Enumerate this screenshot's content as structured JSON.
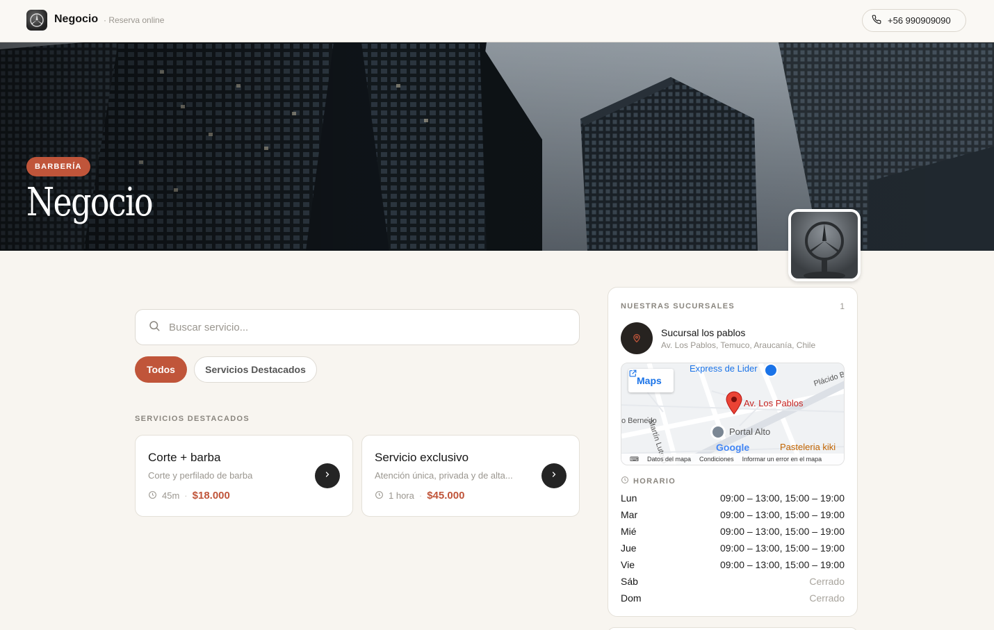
{
  "header": {
    "brand_name": "Negocio",
    "brand_sub": "· Reserva online",
    "phone": "+56 990909090"
  },
  "hero": {
    "tag": "BARBERÍA",
    "title": "Negocio"
  },
  "search": {
    "placeholder": "Buscar servicio..."
  },
  "filters": [
    {
      "label": "Todos",
      "active": true
    },
    {
      "label": "Servicios Destacados",
      "active": false
    }
  ],
  "featured": {
    "section_label": "SERVICIOS DESTACADOS",
    "services": [
      {
        "title": "Corte + barba",
        "description": "Corte y perfilado de barba",
        "duration": "45m",
        "price": "$18.000"
      },
      {
        "title": "Servicio exclusivo",
        "description": "Atención única, privada y de alta...",
        "duration": "1 hora",
        "price": "$45.000"
      }
    ]
  },
  "branches": {
    "heading": "NUESTRAS SUCURSALES",
    "count": "1",
    "branch": {
      "name": "Sucursal los pablos",
      "address": "Av. Los Pablos, Temuco, Araucanía, Chile"
    },
    "map": {
      "button": "Maps",
      "labels": {
        "express": "Express de Lider",
        "place": "Av. Los Pablos",
        "portal": "Portal Alto",
        "pasteleria": "Pasteleria kiki",
        "placido": "Plácido B",
        "bernedo": "o Bernedo",
        "lutero": ". Martín Lutero",
        "google": "Google"
      },
      "footer": [
        "Datos del mapa",
        "Condiciones",
        "Informar un error en el mapa"
      ]
    },
    "hours_heading": "HORARIO",
    "hours": [
      {
        "day": "Lun",
        "value": "09:00 – 13:00, 15:00 – 19:00",
        "closed": false
      },
      {
        "day": "Mar",
        "value": "09:00 – 13:00, 15:00 – 19:00",
        "closed": false
      },
      {
        "day": "Mié",
        "value": "09:00 – 13:00, 15:00 – 19:00",
        "closed": false
      },
      {
        "day": "Jue",
        "value": "09:00 – 13:00, 15:00 – 19:00",
        "closed": false
      },
      {
        "day": "Vie",
        "value": "09:00 – 13:00, 15:00 – 19:00",
        "closed": false
      },
      {
        "day": "Sáb",
        "value": "Cerrado",
        "closed": true
      },
      {
        "day": "Dom",
        "value": "Cerrado",
        "closed": true
      }
    ]
  },
  "colors": {
    "accent": "#c0553a",
    "background": "#f8f5f0",
    "dark_button": "#242424"
  },
  "icons": [
    "logo",
    "phone-icon",
    "search-icon",
    "clock-icon",
    "chevron-right-icon",
    "map-pin-icon",
    "external-link-icon",
    "keyboard-icon"
  ]
}
